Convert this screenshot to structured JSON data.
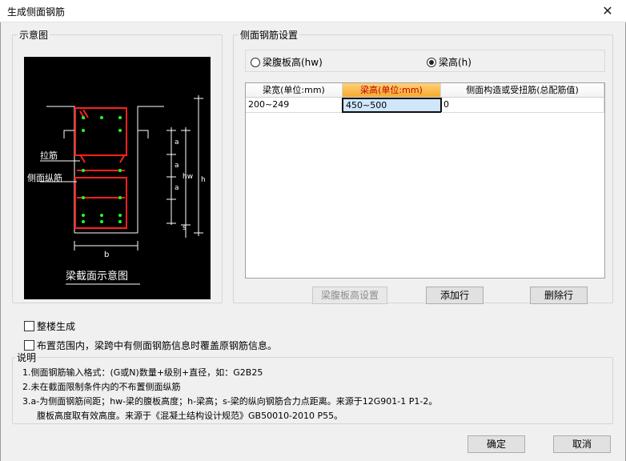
{
  "window": {
    "title": "生成侧面钢筋",
    "close_glyph": "✕"
  },
  "diagram_group": {
    "label": "示意图",
    "diagram": {
      "label_tie": "拉筋",
      "label_side": "侧面纵筋",
      "label_a": "a",
      "label_hw": "hw",
      "label_h": "h",
      "label_s": "s",
      "label_b": "b",
      "caption": "梁截面示意图"
    }
  },
  "settings_group": {
    "label": "侧面钢筋设置",
    "radios": [
      {
        "label": "梁腹板高(hw)",
        "checked": false
      },
      {
        "label": "梁高(h)",
        "checked": true
      }
    ],
    "table": {
      "columns": [
        "梁宽(单位:mm)",
        "梁高(单位:mm)",
        "侧面构造或受扭筋(总配筋值)"
      ],
      "rows": [
        [
          "200~249",
          "450~500",
          "0"
        ]
      ]
    },
    "buttons": {
      "web_height": "梁腹板高设置",
      "add_row": "添加行",
      "delete_row": "删除行"
    }
  },
  "options": {
    "whole_building": "整楼生成",
    "overwrite": "布置范围内，梁跨中有侧面钢筋信息时覆盖原钢筋信息。"
  },
  "notes": {
    "label": "说明",
    "lines": [
      "1.侧面钢筋输入格式：(G或N)数量+级别+直径，如：G2B25",
      "2.未在截面限制条件内的不布置侧面纵筋",
      "3.a-为侧面钢筋间距；hw-梁的腹板高度；h-梁高；s-梁的纵向钢筋合力点距离。来源于12G901-1 P1-2。",
      "腹板高度取有效高度。来源于《混凝土结构设计规范》GB50010-2010 P55。"
    ]
  },
  "footer": {
    "ok": "确定",
    "cancel": "取消"
  }
}
